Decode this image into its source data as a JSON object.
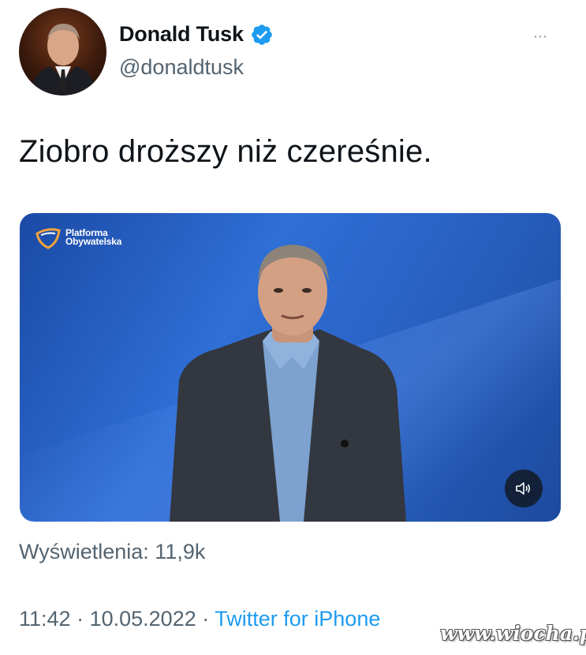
{
  "author": {
    "display_name": "Donald Tusk",
    "handle": "@donaldtusk",
    "verified": true,
    "verified_color": "#1d9bf0"
  },
  "more_icon": "⋯",
  "tweet": {
    "text": "Ziobro droższy niż czereśnie.",
    "media_logo_text": "Platforma Obywatelska",
    "views": "Wyświetlenia: 11,9k",
    "time": "11:42",
    "date": "10.05.2022",
    "separator": "·",
    "source": "Twitter for iPhone"
  },
  "watermark": "www.wiocha.pl",
  "colors": {
    "accent": "#1d9bf0",
    "secondary_text": "#536471",
    "media_bg": "#2f6fd6"
  }
}
